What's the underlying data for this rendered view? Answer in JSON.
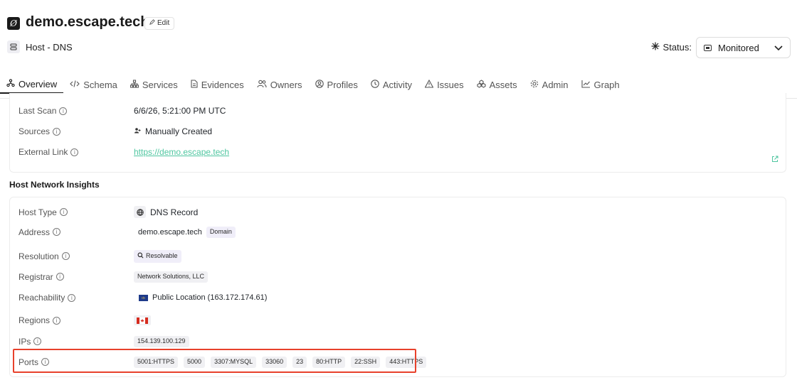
{
  "header": {
    "title": "demo.escape.tech",
    "edit_label": "Edit",
    "subtitle": "Host - DNS",
    "status_label": "Status:",
    "status_value": "Monitored"
  },
  "tabs": [
    {
      "label": "Overview",
      "icon": "overview-icon",
      "active": true
    },
    {
      "label": "Schema",
      "icon": "code-icon"
    },
    {
      "label": "Services",
      "icon": "services-icon"
    },
    {
      "label": "Evidences",
      "icon": "document-icon"
    },
    {
      "label": "Owners",
      "icon": "users-icon"
    },
    {
      "label": "Profiles",
      "icon": "profile-icon"
    },
    {
      "label": "Activity",
      "icon": "clock-icon"
    },
    {
      "label": "Issues",
      "icon": "warning-icon"
    },
    {
      "label": "Assets",
      "icon": "assets-icon"
    },
    {
      "label": "Admin",
      "icon": "gear-icon"
    },
    {
      "label": "Graph",
      "icon": "chart-icon"
    }
  ],
  "details": {
    "last_scan_label": "Last Scan",
    "last_scan_value": "6/6/26, 5:21:00 PM UTC",
    "sources_label": "Sources",
    "sources_value": "Manually Created",
    "external_link_label": "External Link",
    "external_link_value": "https://demo.escape.tech"
  },
  "insights": {
    "title": "Host Network Insights",
    "host_type_label": "Host Type",
    "host_type_value": "DNS Record",
    "address_label": "Address",
    "address_value": "demo.escape.tech",
    "address_badge": "Domain",
    "resolution_label": "Resolution",
    "resolution_value": "Resolvable",
    "registrar_label": "Registrar",
    "registrar_value": "Network Solutions, LLC",
    "reachability_label": "Reachability",
    "reachability_value": "Public Location (163.172.174.61)",
    "regions_label": "Regions",
    "region_flag": "canada-flag",
    "ips_label": "IPs",
    "ips_value": "154.139.100.129",
    "ports_label": "Ports",
    "ports": [
      "5001:HTTPS",
      "5000",
      "3307:MYSQL",
      "33060",
      "23",
      "80:HTTP",
      "22:SSH",
      "443:HTTPS"
    ]
  },
  "colors": {
    "accent_link": "#4fc6a0",
    "highlight": "#e8412b"
  }
}
